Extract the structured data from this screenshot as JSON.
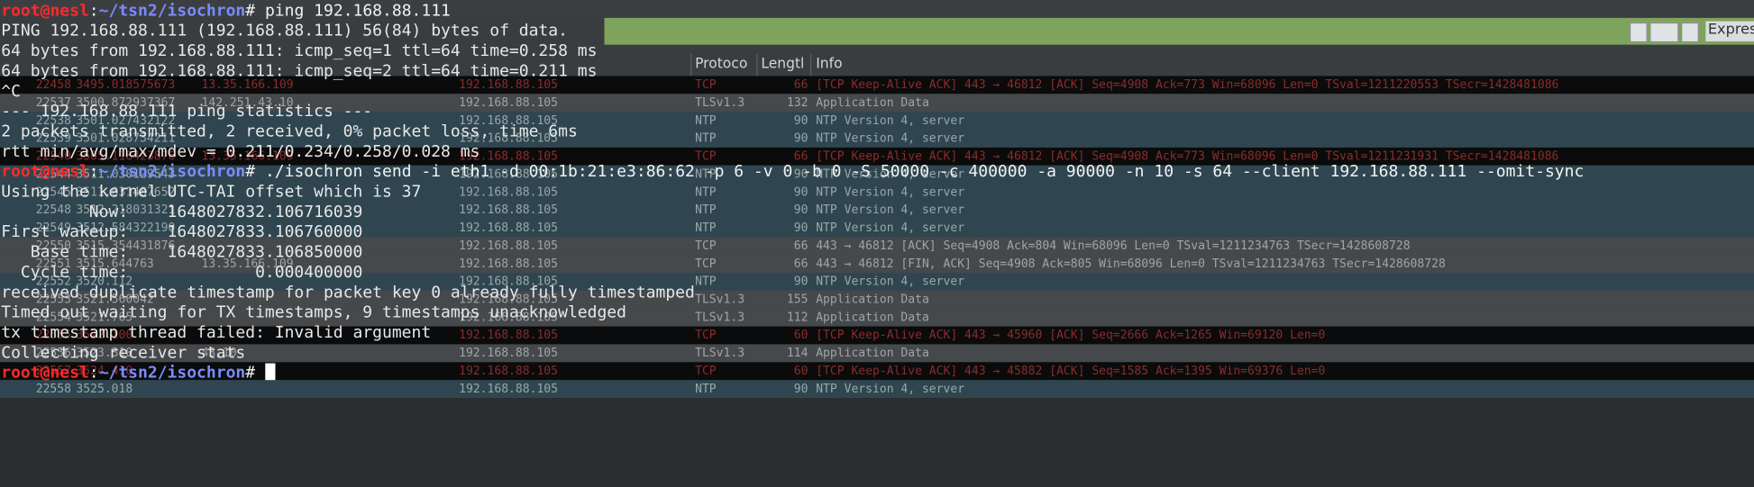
{
  "wireshark": {
    "express_label": "Expres",
    "columns": {
      "protocol": "Protoco",
      "length": "Lengtl",
      "info": "Info"
    },
    "rows": [
      {
        "no": "22458",
        "time": "3495.018575673",
        "src": "13.35.166.109",
        "dst": "192.168.88.105",
        "proto": "TCP",
        "len": "66",
        "info": "[TCP Keep-Alive ACK] 443 → 46812 [ACK] Seq=4908 Ack=773 Win=68096 Len=0 TSval=1211220553 TSecr=1428481086",
        "style": "black"
      },
      {
        "no": "22537",
        "time": "3500.872937367",
        "src": "142.251.43.10",
        "dst": "192.168.88.105",
        "proto": "TLSv1.3",
        "len": "132",
        "info": "Application Data",
        "style": "gray"
      },
      {
        "no": "22538",
        "time": "3501.027432122",
        "src": "",
        "dst": "192.168.88.105",
        "proto": "NTP",
        "len": "90",
        "info": "NTP Version 4, server",
        "style": "teal"
      },
      {
        "no": "22539",
        "time": "3501.028734211",
        "src": "",
        "dst": "192.168.88.105",
        "proto": "NTP",
        "len": "90",
        "info": "NTP Version 4, server",
        "style": "teal"
      },
      {
        "no": "22540",
        "time": "3505.118423876",
        "src": "13.35.166.109",
        "dst": "192.168.88.105",
        "proto": "TCP",
        "len": "66",
        "info": "[TCP Keep-Alive ACK] 443 → 46812 [ACK] Seq=4908 Ack=773 Win=68096 Len=0 TSval=1211231931 TSecr=1428481086",
        "style": "black"
      },
      {
        "no": "22544",
        "time": "3511.030129543",
        "src": "",
        "dst": "192.168.88.105",
        "proto": "NTP",
        "len": "90",
        "info": "NTP Version 4, server",
        "style": "teal"
      },
      {
        "no": "22545",
        "time": "3511.031487652",
        "src": "",
        "dst": "192.168.88.105",
        "proto": "NTP",
        "len": "90",
        "info": "NTP Version 4, server",
        "style": "teal"
      },
      {
        "no": "22548",
        "time": "3512.218031321",
        "src": "",
        "dst": "192.168.88.105",
        "proto": "NTP",
        "len": "90",
        "info": "NTP Version 4, server",
        "style": "teal"
      },
      {
        "no": "22549",
        "time": "3512.584322190",
        "src": "",
        "dst": "192.168.88.105",
        "proto": "NTP",
        "len": "90",
        "info": "NTP Version 4, server",
        "style": "teal"
      },
      {
        "no": "22550",
        "time": "3515.354431876",
        "src": "",
        "dst": "192.168.88.105",
        "proto": "TCP",
        "len": "66",
        "info": "443 → 46812 [ACK] Seq=4908 Ack=804 Win=68096 Len=0 TSval=1211234763 TSecr=1428608728",
        "style": "gray"
      },
      {
        "no": "22551",
        "time": "3515.644763",
        "src": "13.35.166.109",
        "dst": "192.168.88.105",
        "proto": "TCP",
        "len": "66",
        "info": "443 → 46812 [FIN, ACK] Seq=4908 Ack=805 Win=68096 Len=0 TSval=1211234763 TSecr=1428608728",
        "style": "gray"
      },
      {
        "no": "22552",
        "time": "3520.112",
        "src": "",
        "dst": "192.168.88.105",
        "proto": "NTP",
        "len": "90",
        "info": "NTP Version 4, server",
        "style": "teal"
      },
      {
        "no": "22553",
        "time": "3521.560042",
        "src": "",
        "dst": "192.168.88.105",
        "proto": "TLSv1.3",
        "len": "155",
        "info": "Application Data",
        "style": "gray"
      },
      {
        "no": "22554",
        "time": "3521.765",
        "src": "",
        "dst": "192.168.88.105",
        "proto": "TLSv1.3",
        "len": "112",
        "info": "Application Data",
        "style": "gray"
      },
      {
        "no": "22555",
        "time": "3522.100",
        "src": "",
        "dst": "192.168.88.105",
        "proto": "TCP",
        "len": "60",
        "info": "[TCP Keep-Alive ACK] 443 → 45960 [ACK] Seq=2666 Ack=1265 Win=69120 Len=0",
        "style": "black"
      },
      {
        "no": "22556",
        "time": "3523.310",
        "src": "43.10",
        "dst": "192.168.88.105",
        "proto": "TLSv1.3",
        "len": "114",
        "info": "Application Data",
        "style": "gray"
      },
      {
        "no": "22557",
        "time": "3524.410",
        "src": "",
        "dst": "192.168.88.105",
        "proto": "TCP",
        "len": "60",
        "info": "[TCP Keep-Alive ACK] 443 → 45882 [ACK] Seq=1585 Ack=1395 Win=69376 Len=0",
        "style": "black"
      },
      {
        "no": "22558",
        "time": "3525.018",
        "src": "",
        "dst": "192.168.88.105",
        "proto": "NTP",
        "len": "90",
        "info": "NTP Version 4, server",
        "style": "teal"
      }
    ]
  },
  "terminal": {
    "lines": [
      {
        "kind": "prompt",
        "user": "root@nesl",
        "sep": ":",
        "path": "~/tsn2/isochron",
        "sym": "#",
        "cmd": " ping 192.168.88.111"
      },
      {
        "kind": "out",
        "text": "PING 192.168.88.111 (192.168.88.111) 56(84) bytes of data."
      },
      {
        "kind": "out",
        "text": "64 bytes from 192.168.88.111: icmp_seq=1 ttl=64 time=0.258 ms"
      },
      {
        "kind": "out",
        "text": "64 bytes from 192.168.88.111: icmp_seq=2 ttl=64 time=0.211 ms"
      },
      {
        "kind": "out",
        "text": "^C"
      },
      {
        "kind": "out",
        "text": "--- 192.168.88.111 ping statistics ---"
      },
      {
        "kind": "out",
        "text": "2 packets transmitted, 2 received, 0% packet loss, time 6ms"
      },
      {
        "kind": "out",
        "text": "rtt min/avg/max/mdev = 0.211/0.234/0.258/0.028 ms"
      },
      {
        "kind": "prompt",
        "user": "root@nesl",
        "sep": ":",
        "path": "~/tsn2/isochron",
        "sym": "#",
        "cmd": " ./isochron send -i eth1 -d 00:1b:21:e3:86:62 -p 6 -v 0 -b 0 -S 50000 -c 400000 -a 90000 -n 10 -s 64 --client 192.168.88.111 --omit-sync"
      },
      {
        "kind": "out",
        "text": "Using the kernel UTC-TAI offset which is 37"
      },
      {
        "kind": "out",
        "text": "         Now:    1648027832.106716039"
      },
      {
        "kind": "out",
        "text": "First wakeup:    1648027833.106760000"
      },
      {
        "kind": "out",
        "text": "   Base time:    1648027833.106850000"
      },
      {
        "kind": "out",
        "text": "  Cycle time:             0.000400000"
      },
      {
        "kind": "out",
        "text": "received duplicate timestamp for packet key 0 already fully timestamped"
      },
      {
        "kind": "out",
        "text": "Timed out waiting for TX timestamps, 9 timestamps unacknowledged"
      },
      {
        "kind": "out",
        "text": "tx timestamp thread failed: Invalid argument"
      },
      {
        "kind": "out",
        "text": "Collecting receiver stats"
      },
      {
        "kind": "prompt",
        "user": "root@nesl",
        "sep": ":",
        "path": "~/tsn2/isochron",
        "sym": "#",
        "cmd": " "
      }
    ]
  }
}
